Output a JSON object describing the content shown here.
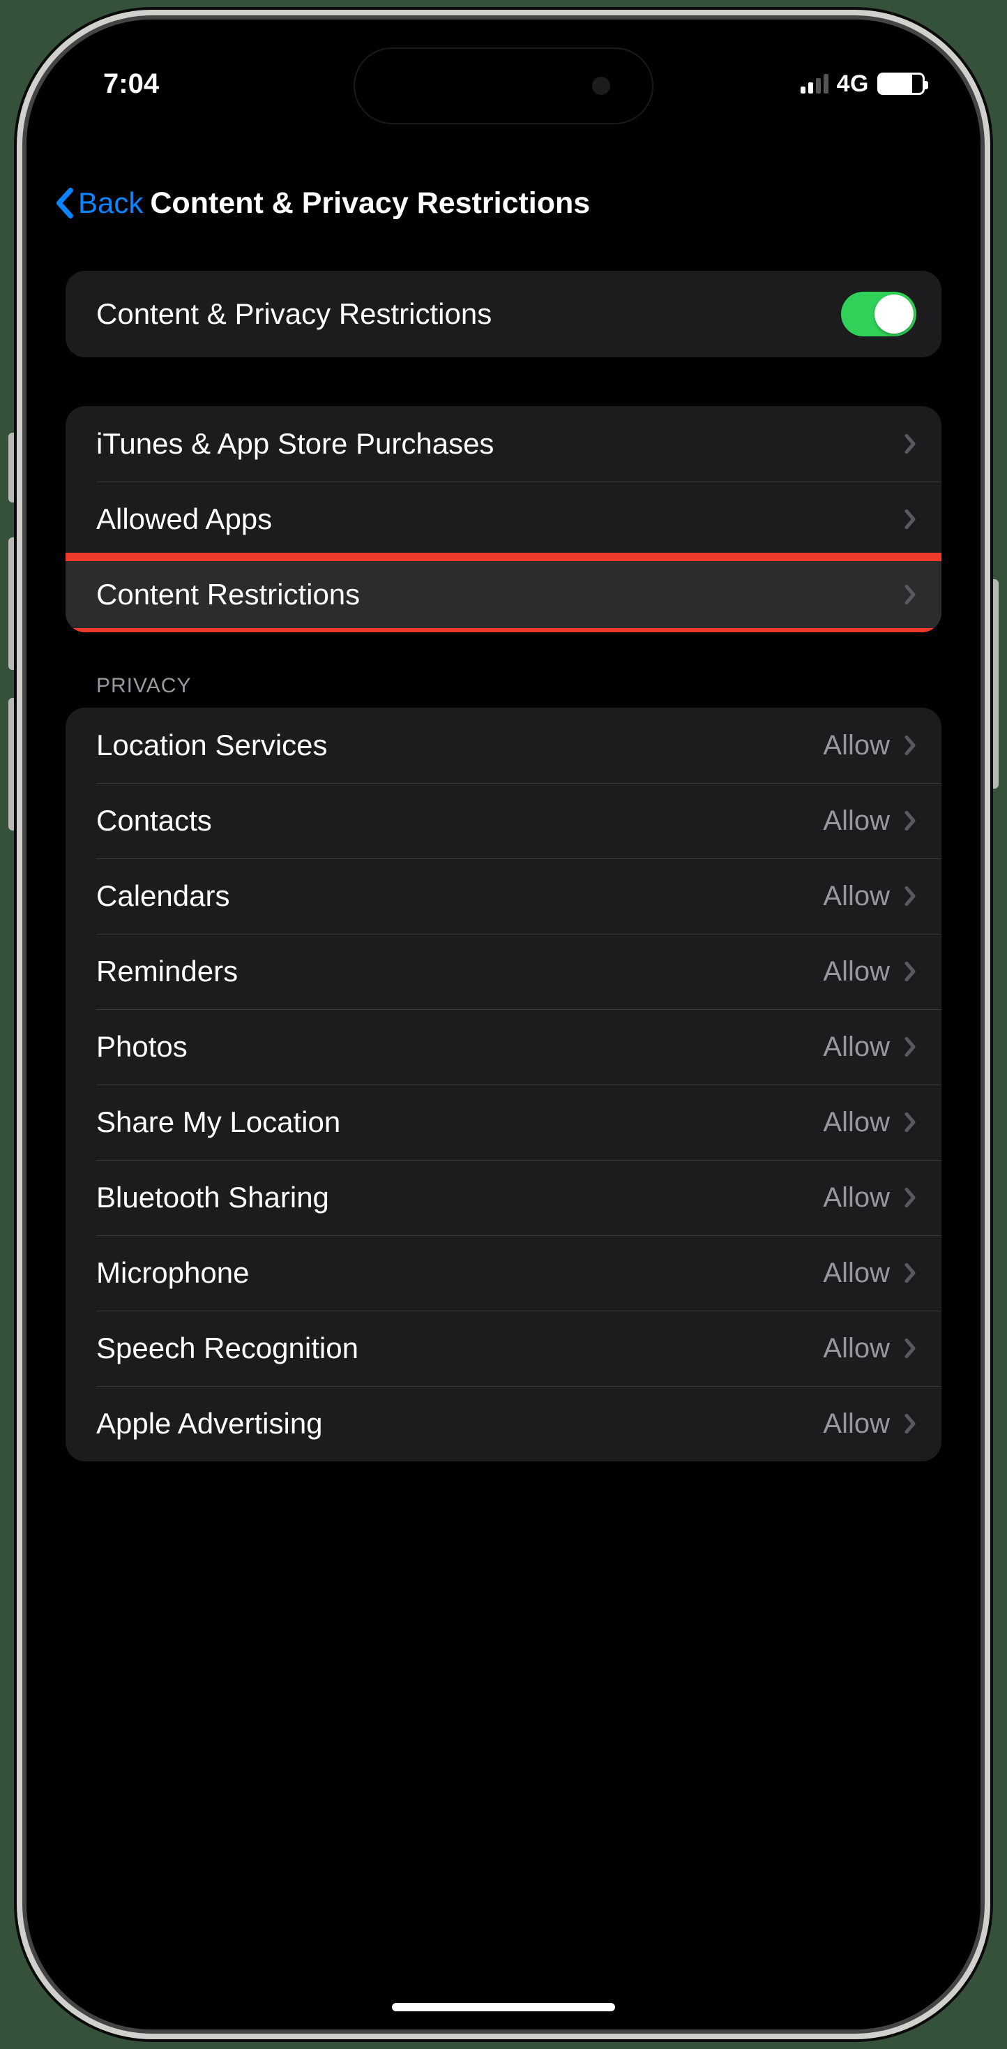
{
  "status": {
    "time": "7:04",
    "network": "4G"
  },
  "nav": {
    "back": "Back",
    "title": "Content & Privacy Restrictions"
  },
  "master_toggle": {
    "label": "Content & Privacy Restrictions",
    "on": true
  },
  "group1": [
    {
      "label": "iTunes & App Store Purchases"
    },
    {
      "label": "Allowed Apps"
    },
    {
      "label": "Content Restrictions",
      "highlighted": true
    }
  ],
  "privacy_header": "Privacy",
  "privacy": [
    {
      "label": "Location Services",
      "value": "Allow"
    },
    {
      "label": "Contacts",
      "value": "Allow"
    },
    {
      "label": "Calendars",
      "value": "Allow"
    },
    {
      "label": "Reminders",
      "value": "Allow"
    },
    {
      "label": "Photos",
      "value": "Allow"
    },
    {
      "label": "Share My Location",
      "value": "Allow"
    },
    {
      "label": "Bluetooth Sharing",
      "value": "Allow"
    },
    {
      "label": "Microphone",
      "value": "Allow"
    },
    {
      "label": "Speech Recognition",
      "value": "Allow"
    },
    {
      "label": "Apple Advertising",
      "value": "Allow"
    }
  ]
}
